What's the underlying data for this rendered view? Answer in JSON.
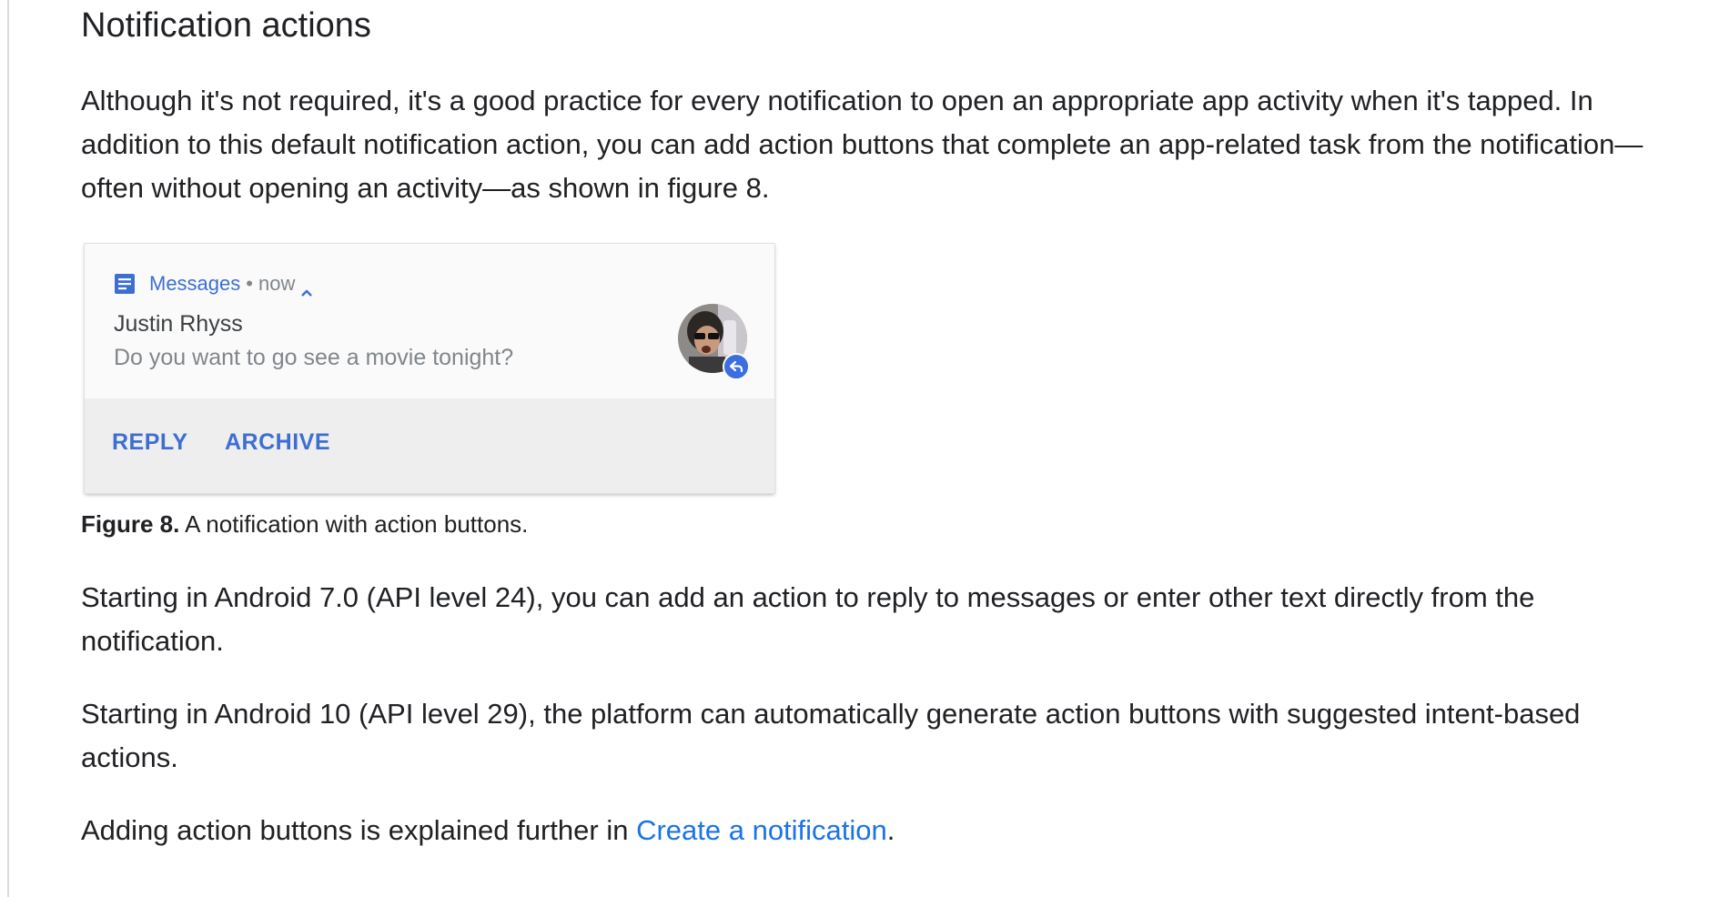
{
  "section": {
    "title": "Notification actions"
  },
  "paragraphs": {
    "intro": "Although it's not required, it's a good practice for every notification to open an appropriate app activity when it's tapped. In addition to this default notification action, you can add action buttons that complete an app-related task from the notification—often without opening an activity—as shown in figure 8.",
    "android7": "Starting in Android 7.0 (API level 24), you can add an action to reply to messages or enter other text directly from the notification.",
    "android10": "Starting in Android 10 (API level 29), the platform can automatically generate action buttons with suggested intent-based actions.",
    "further_prefix": "Adding action buttons is explained further in ",
    "further_link": "Create a notification",
    "further_suffix": "."
  },
  "figure": {
    "notification": {
      "app_icon": "messages-app-icon",
      "app_name": "Messages",
      "separator": "•",
      "time": "now",
      "expand_icon": "chevron-up-icon",
      "sender": "Justin Rhyss",
      "message": "Do you want to go see a movie tonight?",
      "avatar_icon": "contact-avatar",
      "reply_badge_icon": "reply-arrow-icon",
      "actions": [
        "REPLY",
        "ARCHIVE"
      ]
    },
    "caption_label": "Figure 8.",
    "caption_text": " A notification with action buttons."
  },
  "colors": {
    "accent": "#3d6fd1",
    "link": "#1a73e8",
    "text": "#202124",
    "secondary_text": "#80868b"
  }
}
